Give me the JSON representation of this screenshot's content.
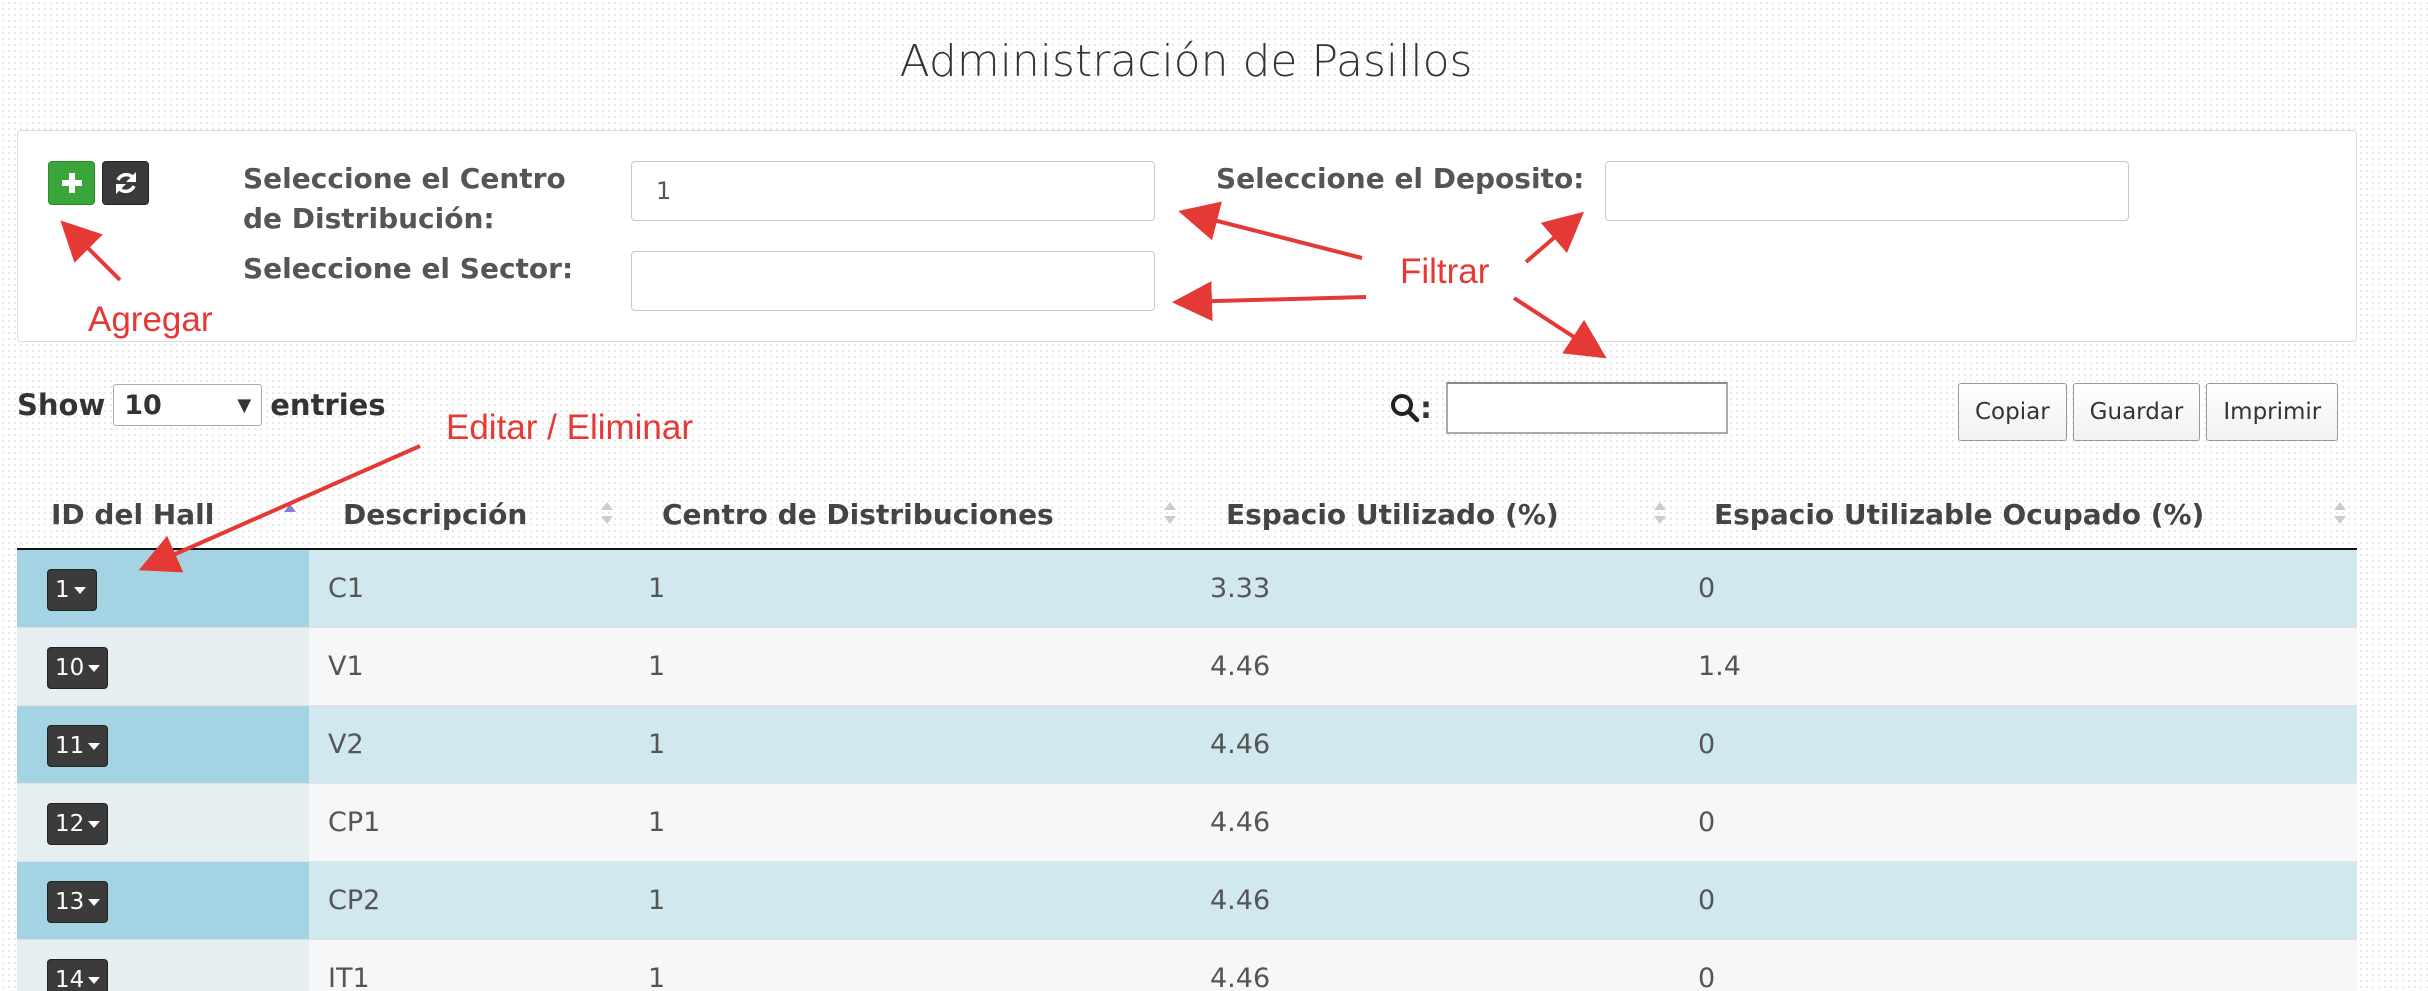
{
  "page": {
    "title": "Administración de Pasillos"
  },
  "filters": {
    "centro_label": "Seleccione el Centro de Distribución:",
    "centro_value": "1",
    "deposito_label": "Seleccione el Deposito:",
    "deposito_value": "",
    "sector_label": "Seleccione el Sector:",
    "sector_value": ""
  },
  "controls": {
    "show_label": "Show",
    "entries_value": "10",
    "entries_label": "entries",
    "search_label": ":",
    "search_value": "",
    "export_buttons": [
      "Copiar",
      "Guardar",
      "Imprimir"
    ]
  },
  "table": {
    "columns": [
      "ID del Hall",
      "Descripción",
      "Centro de Distribuciones",
      "Espacio Utilizado (%)",
      "Espacio Utilizable Ocupado (%)"
    ],
    "rows": [
      {
        "id": "1",
        "descripcion": "C1",
        "centro": "1",
        "utilizado": "3.33",
        "ocupado": "0"
      },
      {
        "id": "10",
        "descripcion": "V1",
        "centro": "1",
        "utilizado": "4.46",
        "ocupado": "1.4"
      },
      {
        "id": "11",
        "descripcion": "V2",
        "centro": "1",
        "utilizado": "4.46",
        "ocupado": "0"
      },
      {
        "id": "12",
        "descripcion": "CP1",
        "centro": "1",
        "utilizado": "4.46",
        "ocupado": "0"
      },
      {
        "id": "13",
        "descripcion": "CP2",
        "centro": "1",
        "utilizado": "4.46",
        "ocupado": "0"
      },
      {
        "id": "14",
        "descripcion": "IT1",
        "centro": "1",
        "utilizado": "4.46",
        "ocupado": "0"
      }
    ]
  },
  "annotations": {
    "agregar": "Agregar",
    "filtrar": "Filtrar",
    "editar": "Editar / Eliminar",
    "color": "#e53935"
  },
  "icons": [
    "plus-icon",
    "refresh-icon",
    "search-icon",
    "sort-icon",
    "caret-down-icon"
  ],
  "colors": {
    "add_button": "#3aa53a",
    "dark_button": "#3a3a3a",
    "row_odd": "#d2e8ef",
    "row_id_odd": "#a4d4e3"
  }
}
